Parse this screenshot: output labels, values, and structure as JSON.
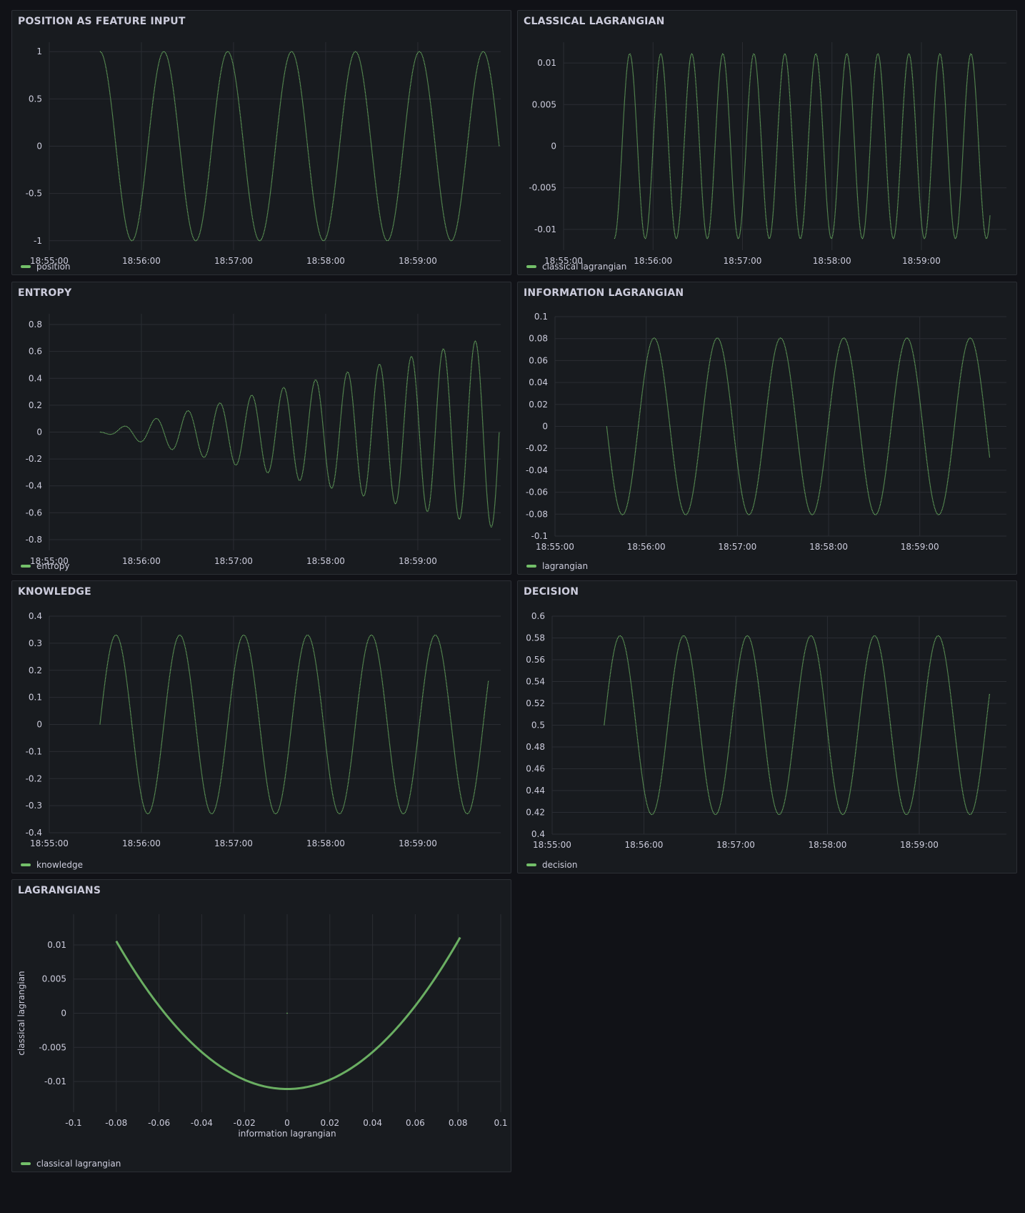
{
  "colors": {
    "series": "#73bf69",
    "grid": "#2a2d33"
  },
  "panels": [
    {
      "id": "position",
      "title": "POSITION AS FEATURE INPUT",
      "legend": "position",
      "chart_data": {
        "type": "line",
        "x_kind": "time",
        "ylim": [
          -1.1,
          1.1
        ],
        "y_ticks": [
          1,
          0.5,
          0,
          -0.5,
          -1
        ],
        "y_tick_labels": [
          "1",
          "0.5",
          "0",
          "-0.5",
          "-1"
        ],
        "x_ticks": [
          "18:55:00",
          "18:56:00",
          "18:57:00",
          "18:58:00",
          "18:59:00"
        ],
        "x_range": [
          "18:55:00",
          "18:59:54"
        ],
        "series": [
          {
            "name": "position",
            "function": "cos",
            "amplitude": 1,
            "offset": 0,
            "start": "18:55:33",
            "end": "18:59:53",
            "period_s": 41.6
          }
        ]
      }
    },
    {
      "id": "classical",
      "title": "CLASSICAL LAGRANGIAN",
      "legend": "classical lagrangian",
      "chart_data": {
        "type": "line",
        "x_kind": "time",
        "ylim": [
          -0.0125,
          0.0125
        ],
        "y_ticks": [
          0.01,
          0.005,
          0,
          -0.005,
          -0.01
        ],
        "y_tick_labels": [
          "0.01",
          "0.005",
          "0",
          "-0.005",
          "-0.01"
        ],
        "x_ticks": [
          "18:55:00",
          "18:56:00",
          "18:57:00",
          "18:58:00",
          "18:59:00"
        ],
        "x_range": [
          "18:55:00",
          "18:59:57"
        ],
        "series": [
          {
            "name": "classical lagrangian",
            "function": "negcos",
            "amplitude": 0.0111,
            "offset": 0,
            "start": "18:55:34",
            "end": "18:59:46",
            "period_s": 20.8
          }
        ]
      }
    },
    {
      "id": "entropy",
      "title": "ENTROPY",
      "legend": "entropy",
      "chart_data": {
        "type": "line",
        "x_kind": "time",
        "ylim": [
          -0.88,
          0.88
        ],
        "y_ticks": [
          0.8,
          0.6,
          0.4,
          0.2,
          0,
          -0.2,
          -0.4,
          -0.6,
          -0.8
        ],
        "y_tick_labels": [
          "0.8",
          "0.6",
          "0.4",
          "0.2",
          "0",
          "-0.2",
          "-0.4",
          "-0.6",
          "-0.8"
        ],
        "x_ticks": [
          "18:55:00",
          "18:56:00",
          "18:57:00",
          "18:58:00",
          "18:59:00"
        ],
        "x_range": [
          "18:55:00",
          "18:59:54"
        ],
        "series": [
          {
            "name": "entropy",
            "function": "growing_sin",
            "amplitude": 0.72,
            "offset": 0,
            "start": "18:55:33",
            "end": "18:59:53",
            "period_s": 20.8
          }
        ]
      }
    },
    {
      "id": "information",
      "title": "INFORMATION LAGRANGIAN",
      "legend": "lagrangian",
      "chart_data": {
        "type": "line",
        "x_kind": "time",
        "ylim": [
          -0.1,
          0.1
        ],
        "y_ticks": [
          0.1,
          0.08,
          0.06,
          0.04,
          0.02,
          0,
          -0.02,
          -0.04,
          -0.06,
          -0.08,
          -0.1
        ],
        "y_tick_labels": [
          "0.1",
          "0.08",
          "0.06",
          "0.04",
          "0.02",
          "0",
          "-0.02",
          "-0.04",
          "-0.06",
          "-0.08",
          "-0.1"
        ],
        "x_ticks": [
          "18:55:00",
          "18:56:00",
          "18:57:00",
          "18:58:00",
          "18:59:00"
        ],
        "x_range": [
          "18:55:00",
          "18:59:57"
        ],
        "series": [
          {
            "name": "lagrangian",
            "function": "negsin",
            "amplitude": 0.0805,
            "offset": 0,
            "start": "18:55:34",
            "end": "18:59:46",
            "period_s": 41.6
          }
        ]
      }
    },
    {
      "id": "knowledge",
      "title": "KNOWLEDGE",
      "legend": "knowledge",
      "chart_data": {
        "type": "line",
        "x_kind": "time",
        "ylim": [
          -0.4,
          0.4
        ],
        "y_ticks": [
          0.4,
          0.3,
          0.2,
          0.1,
          0,
          -0.1,
          -0.2,
          -0.3,
          -0.4
        ],
        "y_tick_labels": [
          "0.4",
          "0.3",
          "0.2",
          "0.1",
          "0",
          "-0.1",
          "-0.2",
          "-0.3",
          "-0.4"
        ],
        "x_ticks": [
          "18:55:00",
          "18:56:00",
          "18:57:00",
          "18:58:00",
          "18:59:00"
        ],
        "x_range": [
          "18:55:00",
          "18:59:54"
        ],
        "series": [
          {
            "name": "knowledge",
            "function": "sin",
            "amplitude": 0.33,
            "offset": 0,
            "start": "18:55:33",
            "end": "18:59:46",
            "period_s": 41.6
          }
        ]
      }
    },
    {
      "id": "decision",
      "title": "DECISION",
      "legend": "decision",
      "chart_data": {
        "type": "line",
        "x_kind": "time",
        "ylim": [
          0.4,
          0.6
        ],
        "y_ticks": [
          0.6,
          0.58,
          0.56,
          0.54,
          0.52,
          0.5,
          0.48,
          0.46,
          0.44,
          0.42,
          0.4
        ],
        "y_tick_labels": [
          "0.6",
          "0.58",
          "0.56",
          "0.54",
          "0.52",
          "0.5",
          "0.48",
          "0.46",
          "0.44",
          "0.42",
          "0.4"
        ],
        "x_ticks": [
          "18:55:00",
          "18:56:00",
          "18:57:00",
          "18:58:00",
          "18:59:00"
        ],
        "x_range": [
          "18:55:00",
          "18:59:57"
        ],
        "series": [
          {
            "name": "decision",
            "function": "sin",
            "amplitude": 0.082,
            "offset": 0.5,
            "start": "18:55:34",
            "end": "18:59:46",
            "period_s": 41.6
          }
        ]
      }
    },
    {
      "id": "lagrangians",
      "title": "LAGRANGIANS",
      "legend": "classical lagrangian",
      "chart_data": {
        "type": "scatter",
        "x_kind": "value",
        "xlabel": "information lagrangian",
        "ylabel": "classical lagrangian",
        "xlim": [
          -0.1,
          0.1
        ],
        "ylim": [
          -0.0145,
          0.0145
        ],
        "x_ticks": [
          -0.1,
          -0.08,
          -0.06,
          -0.04,
          -0.02,
          0,
          0.02,
          0.04,
          0.06,
          0.08,
          0.1
        ],
        "x_tick_labels": [
          "-0.1",
          "-0.08",
          "-0.06",
          "-0.04",
          "-0.02",
          "0",
          "0.02",
          "0.04",
          "0.06",
          "0.08",
          "0.1"
        ],
        "y_ticks": [
          0.01,
          0.005,
          0,
          -0.005,
          -0.01
        ],
        "y_tick_labels": [
          "0.01",
          "0.005",
          "0",
          "-0.005",
          "-0.01"
        ],
        "series": [
          {
            "name": "classical lagrangian",
            "function": "parabola",
            "x_from": -0.08,
            "x_to": 0.081,
            "y_min": -0.0111,
            "y_max": 0.0111
          }
        ]
      }
    }
  ]
}
